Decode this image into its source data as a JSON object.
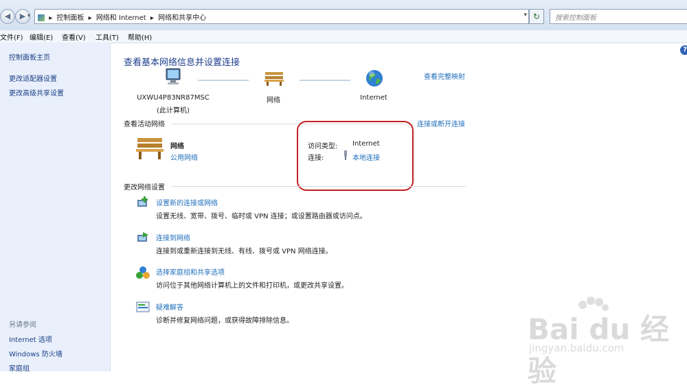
{
  "addressbar": {
    "crumbs": [
      "控制面板",
      "网络和 Internet",
      "网络和共享中心"
    ],
    "search_placeholder": "搜索控制面板"
  },
  "menu": [
    "文件(F)",
    "编辑(E)",
    "查看(V)",
    "工具(T)",
    "帮助(H)"
  ],
  "sidebar": {
    "home": "控制面板主页",
    "links": [
      "更改适配器设置",
      "更改高级共享设置"
    ],
    "see_also_title": "另请参阅",
    "see_also": [
      "Internet 选项",
      "Windows 防火墙",
      "家庭组"
    ]
  },
  "main": {
    "title": "查看基本网络信息并设置连接",
    "view_full_map": "查看完整映射",
    "computer_name": "UXWU4P83NR87MSC",
    "computer_sub": "(此计算机)",
    "network_node": "网络",
    "internet_node": "Internet",
    "active_heading": "查看活动网络",
    "connect_disconnect": "连接或断开连接",
    "network_name": "网络",
    "network_type": "公用网络",
    "access_type_label": "访问类型:",
    "access_type_value": "Internet",
    "connection_label": "连接:",
    "connection_value": "本地连接",
    "change_heading": "更改网络设置",
    "tasks": [
      {
        "title": "设置新的连接或网络",
        "desc": "设置无线、宽带、拨号、临时或 VPN 连接；或设置路由器或访问点。"
      },
      {
        "title": "连接到网络",
        "desc": "连接到或重新连接到无线、有线、拨号或 VPN 网络连接。"
      },
      {
        "title": "选择家庭组和共享选项",
        "desc": "访问位于其他网络计算机上的文件和打印机，或更改共享设置。"
      },
      {
        "title": "疑难解答",
        "desc": "诊断并修复网络问题，或获得故障排除信息。"
      }
    ]
  },
  "watermark": {
    "brand": "Bai du 经验",
    "url": "jingyan.baidu.com"
  }
}
